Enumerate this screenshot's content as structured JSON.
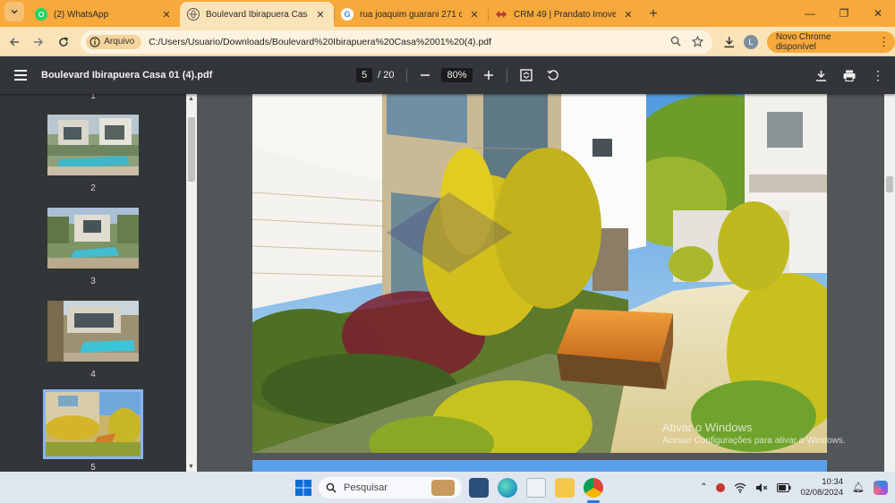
{
  "browser": {
    "tabs": [
      {
        "title": "(2) WhatsApp",
        "icon": "whatsapp-icon",
        "active": false
      },
      {
        "title": "Boulevard Ibirapuera Casa 01 (4",
        "icon": "globe-icon",
        "active": true
      },
      {
        "title": "rua joaquim guarani 271 condo",
        "icon": "google-icon",
        "active": false
      },
      {
        "title": "CRM 49 | Prandato Imoveis",
        "icon": "crm-icon",
        "active": false
      }
    ],
    "address_chip": "Arquivo",
    "url": "C:/Users/Usuario/Downloads/Boulevard%20Ibirapuera%20Casa%2001%20(4).pdf",
    "profile_initial": "L",
    "update_button": "Novo Chrome disponível"
  },
  "pdf": {
    "title": "Boulevard Ibirapuera Casa 01 (4).pdf",
    "current_page": "5",
    "total_pages": "/ 20",
    "zoom": "80%",
    "thumb_labels": [
      "1",
      "2",
      "3",
      "4",
      "5"
    ],
    "selected_page": "5"
  },
  "watermark": {
    "line1": "Ativar o Windows",
    "line2": "Acesse Configurações para ativar o Windows."
  },
  "taskbar": {
    "search_placeholder": "Pesquisar",
    "time": "10:34",
    "date": "02/08/2024"
  }
}
